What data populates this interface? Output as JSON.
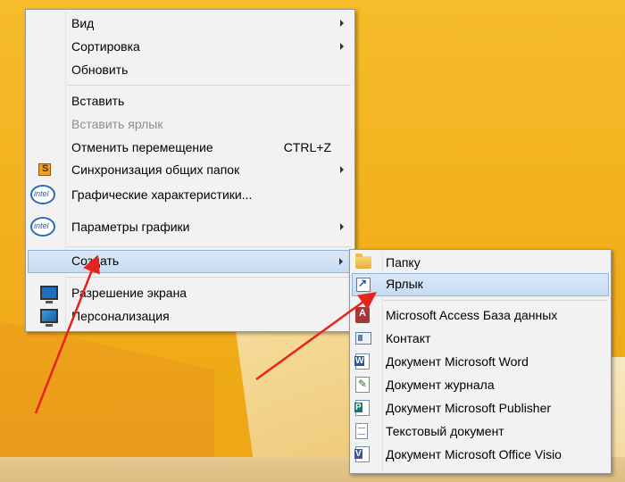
{
  "main_menu": {
    "items": [
      {
        "label": "Вид"
      },
      {
        "label": "Сортировка"
      },
      {
        "label": "Обновить"
      },
      {
        "label": "Вставить"
      },
      {
        "label": "Вставить ярлык"
      },
      {
        "label": "Отменить перемещение",
        "shortcut": "CTRL+Z"
      },
      {
        "label": "Синхронизация общих папок"
      },
      {
        "label": "Графические характеристики..."
      },
      {
        "label": "Параметры графики"
      },
      {
        "label": "Создать"
      },
      {
        "label": "Разрешение экрана"
      },
      {
        "label": "Персонализация"
      }
    ]
  },
  "submenu": {
    "items": [
      {
        "label": "Папку"
      },
      {
        "label": "Ярлык"
      },
      {
        "label": "Microsoft Access База данных"
      },
      {
        "label": "Контакт"
      },
      {
        "label": "Документ Microsoft Word"
      },
      {
        "label": "Документ журнала"
      },
      {
        "label": "Документ Microsoft Publisher"
      },
      {
        "label": "Текстовый документ"
      },
      {
        "label": "Документ Microsoft Office Visio"
      }
    ]
  },
  "colors": {
    "desktop": "#f4b21c",
    "annotation_arrow": "#e8231c",
    "highlight": "#cce0f6"
  }
}
